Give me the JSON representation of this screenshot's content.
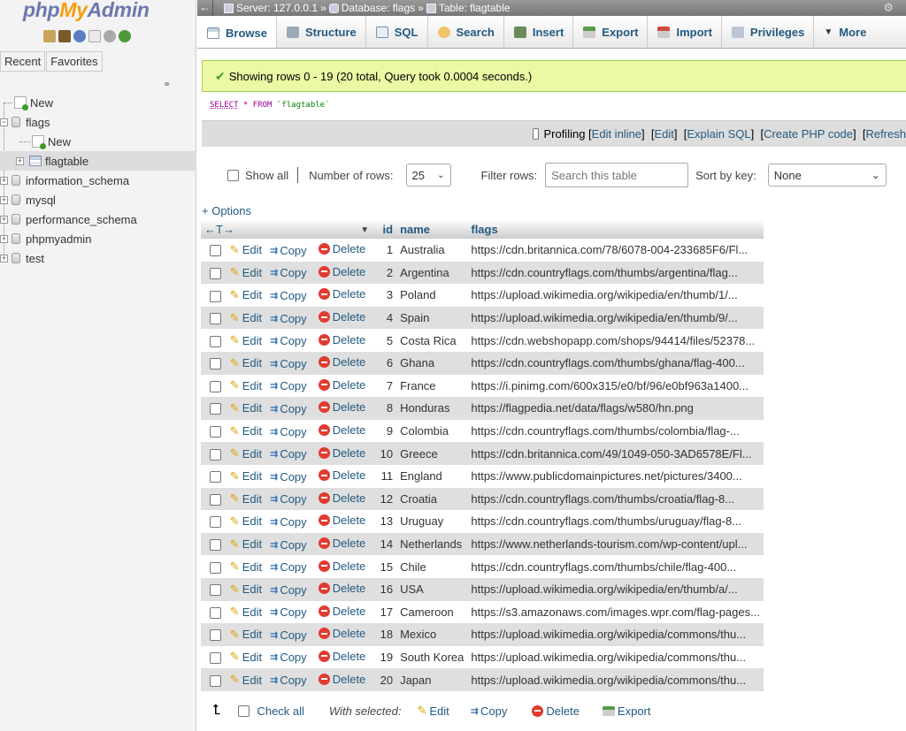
{
  "logo": {
    "php": "php",
    "my": "My",
    "admin": "Admin"
  },
  "nav_tabs": [
    "Recent",
    "Favorites"
  ],
  "tree": {
    "new": "New",
    "flags_db": "flags",
    "flags_new": "New",
    "flags_table": "flagtable",
    "databases": [
      "information_schema",
      "mysql",
      "performance_schema",
      "phpmyadmin",
      "test"
    ]
  },
  "breadcrumb": {
    "server": "Server: 127.0.0.1",
    "sep": "»",
    "database": "Database: flags",
    "table": "Table: flagtable"
  },
  "tabs": [
    "Browse",
    "Structure",
    "SQL",
    "Search",
    "Insert",
    "Export",
    "Import",
    "Privileges",
    "More"
  ],
  "success_message": "Showing rows 0 - 19 (20 total, Query took 0.0004 seconds.)",
  "sql": {
    "select": "SELECT",
    "star": "*",
    "from": "FROM",
    "table": "`flagtable`"
  },
  "sql_tools": {
    "profiling": "Profiling",
    "edit_inline": "Edit inline",
    "edit": "Edit",
    "explain": "Explain SQL",
    "create_php": "Create PHP code",
    "refresh": "Refresh"
  },
  "controls": {
    "show_all": "Show all",
    "number_of_rows": "Number of rows:",
    "rows_value": "25",
    "filter_rows": "Filter rows:",
    "filter_placeholder": "Search this table",
    "sort_by_key": "Sort by key:",
    "sort_value": "None"
  },
  "options_link": "+ Options",
  "columns": {
    "id": "id",
    "name": "name",
    "flags": "flags"
  },
  "actions": {
    "edit": "Edit",
    "copy": "Copy",
    "delete": "Delete"
  },
  "rows": [
    {
      "id": "1",
      "name": "Australia",
      "flags": "https://cdn.britannica.com/78/6078-004-233685F6/Fl..."
    },
    {
      "id": "2",
      "name": "Argentina",
      "flags": "https://cdn.countryflags.com/thumbs/argentina/flag..."
    },
    {
      "id": "3",
      "name": "Poland",
      "flags": "https://upload.wikimedia.org/wikipedia/en/thumb/1/..."
    },
    {
      "id": "4",
      "name": "Spain",
      "flags": "https://upload.wikimedia.org/wikipedia/en/thumb/9/..."
    },
    {
      "id": "5",
      "name": "Costa Rica",
      "flags": "https://cdn.webshopapp.com/shops/94414/files/52378..."
    },
    {
      "id": "6",
      "name": "Ghana",
      "flags": "https://cdn.countryflags.com/thumbs/ghana/flag-400..."
    },
    {
      "id": "7",
      "name": "France",
      "flags": "https://i.pinimg.com/600x315/e0/bf/96/e0bf963a1400..."
    },
    {
      "id": "8",
      "name": "Honduras",
      "flags": "https://flagpedia.net/data/flags/w580/hn.png"
    },
    {
      "id": "9",
      "name": "Colombia",
      "flags": "https://cdn.countryflags.com/thumbs/colombia/flag-..."
    },
    {
      "id": "10",
      "name": "Greece",
      "flags": "https://cdn.britannica.com/49/1049-050-3AD6578E/Fl..."
    },
    {
      "id": "11",
      "name": "England",
      "flags": "https://www.publicdomainpictures.net/pictures/3400..."
    },
    {
      "id": "12",
      "name": "Croatia",
      "flags": "https://cdn.countryflags.com/thumbs/croatia/flag-8..."
    },
    {
      "id": "13",
      "name": "Uruguay",
      "flags": "https://cdn.countryflags.com/thumbs/uruguay/flag-8..."
    },
    {
      "id": "14",
      "name": "Netherlands",
      "flags": "https://www.netherlands-tourism.com/wp-content/upl..."
    },
    {
      "id": "15",
      "name": "Chile",
      "flags": "https://cdn.countryflags.com/thumbs/chile/flag-400..."
    },
    {
      "id": "16",
      "name": "USA",
      "flags": "https://upload.wikimedia.org/wikipedia/en/thumb/a/..."
    },
    {
      "id": "17",
      "name": "Cameroon",
      "flags": "https://s3.amazonaws.com/images.wpr.com/flag-pages..."
    },
    {
      "id": "18",
      "name": "Mexico",
      "flags": "https://upload.wikimedia.org/wikipedia/commons/thu..."
    },
    {
      "id": "19",
      "name": "South Korea",
      "flags": "https://upload.wikimedia.org/wikipedia/commons/thu..."
    },
    {
      "id": "20",
      "name": "Japan",
      "flags": "https://upload.wikimedia.org/wikipedia/commons/thu..."
    }
  ],
  "bottom": {
    "check_all": "Check all",
    "with_selected": "With selected:",
    "edit": "Edit",
    "copy": "Copy",
    "delete": "Delete",
    "export": "Export"
  },
  "colors": {
    "link": "#235a81",
    "success_bg": "#ebf8a4",
    "logo_blue": "#6c78af",
    "logo_orange": "#f89c0e"
  }
}
